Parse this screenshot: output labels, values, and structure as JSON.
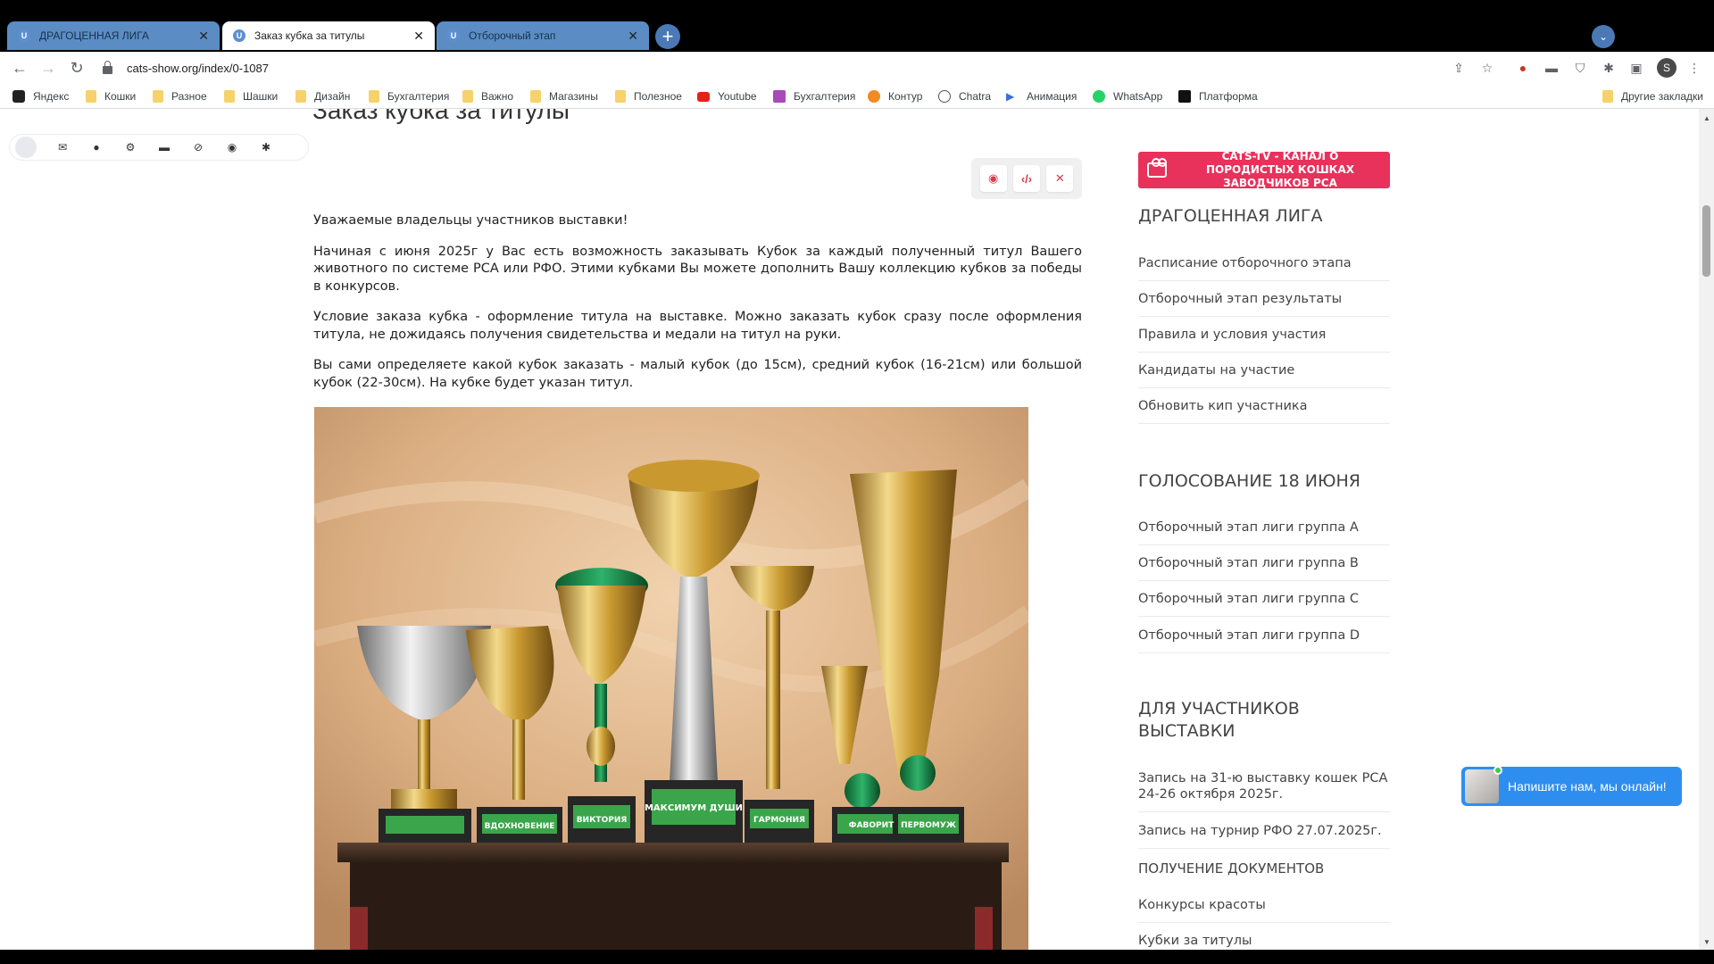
{
  "browser": {
    "tabs": [
      {
        "label": "ДРАГОЦЕННАЯ ЛИГА",
        "favicon": "U",
        "active": false
      },
      {
        "label": "Заказ кубка за титулы",
        "favicon": "U",
        "active": true
      },
      {
        "label": "Отборочный этап",
        "favicon": "U",
        "active": false
      }
    ],
    "url": "cats-show.org/index/0-1087",
    "profile_initial": "S",
    "bookmarks": [
      {
        "label": "Яндекс",
        "icon": "yandex-icon"
      },
      {
        "label": "Кошки",
        "icon": "folder-icon"
      },
      {
        "label": "Разное",
        "icon": "folder-icon"
      },
      {
        "label": "Шашки",
        "icon": "folder-icon"
      },
      {
        "label": "Дизайн",
        "icon": "folder-icon"
      },
      {
        "label": "Бухгалтерия",
        "icon": "folder-icon"
      },
      {
        "label": "Важно",
        "icon": "folder-icon"
      },
      {
        "label": "Магазины",
        "icon": "folder-icon"
      },
      {
        "label": "Полезное",
        "icon": "folder-icon"
      },
      {
        "label": "Youtube",
        "icon": "youtube-icon"
      },
      {
        "label": "Бухгалтерия",
        "icon": "calculator-icon"
      },
      {
        "label": "Контур",
        "icon": "kontur-icon"
      },
      {
        "label": "Chatra",
        "icon": "chat-icon"
      },
      {
        "label": "Анимация",
        "icon": "play-icon"
      },
      {
        "label": "WhatsApp",
        "icon": "whatsapp-icon"
      },
      {
        "label": "Платформа",
        "icon": "platform-icon"
      }
    ],
    "other_bookmarks": "Другие закладки"
  },
  "page": {
    "clipped_title": "Заказ кубка за титулы",
    "paragraphs": [
      "Уважаемые владельцы участников выставки!",
      "Начиная с июня 2025г у Вас есть возможность заказывать Кубок за каждый полученный титул Вашего животного по системе РСА или РФО. Этими кубками Вы можете дополнить Вашу коллекцию кубков за победы в конкурсов.",
      "Условие заказа кубка - оформление титула на выставке. Можно заказать кубок сразу после оформления титула, не дожидаясь получения свидетельства и медали на титул на руки.",
      "Вы сами определяете какой кубок заказать - малый кубок (до 15см), средний кубок (16-21см) или большой кубок (22-30см). На кубке будет указан титул."
    ],
    "trophy_plaques": [
      "ВДОХНОВЕНИЕ",
      "ВИКТОРИЯ",
      "МАКСИМУМ ДУШИ",
      "ГАРМОНИЯ",
      "ФАВОРИТ",
      "ПЕРВОМУЖ"
    ]
  },
  "sidebar": {
    "banner": "CATS-TV - КАНАЛ О ПОРОДИСТЫХ КОШКАХ ЗАВОДЧИКОВ РСА",
    "section1": {
      "title": "ДРАГОЦЕННАЯ ЛИГА",
      "links": [
        "Расписание отборочного этапа",
        "Отборочный этап результаты",
        "Правила и условия участия",
        "Кандидаты на участие",
        "Обновить кип участника"
      ]
    },
    "section2": {
      "title": "ГОЛОСОВАНИЕ 18 ИЮНЯ",
      "links": [
        "Отборочный этап лиги группа А",
        "Отборочный этап лиги группа В",
        "Отборочный этап лиги группа С",
        "Отборочный этап лиги группа D"
      ]
    },
    "section3": {
      "title": "ДЛЯ УЧАСТНИКОВ ВЫСТАВКИ",
      "links": [
        "Запись на 31-ю выставку кошек РСА 24-26 октября 2025г.",
        "Запись на турнир РФО 27.07.2025г."
      ],
      "subheading": "ПОЛУЧЕНИЕ ДОКУМЕНТОВ",
      "links2": [
        "Конкурсы красоты",
        "Кубки за титулы"
      ]
    }
  },
  "chat": {
    "label": "Напишите нам, мы онлайн!"
  },
  "colors": {
    "banner": "#e8315b",
    "chat": "#2e8ef0",
    "tab_inactive": "#5b8dc4"
  }
}
